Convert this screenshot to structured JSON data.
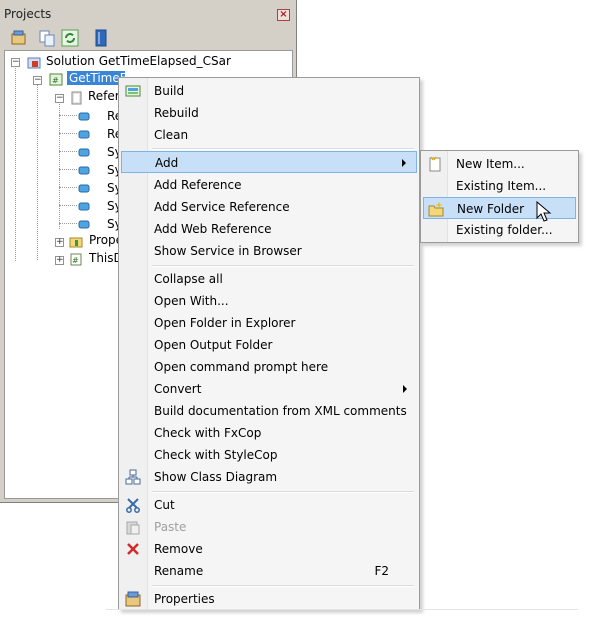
{
  "pad": {
    "title": "Projects",
    "close_glyph": "×",
    "toolbar": [
      {
        "icon": "properties-icon"
      },
      {
        "icon": "copy-icon"
      },
      {
        "icon": "refresh-icon"
      },
      {
        "icon": "collapse-icon"
      }
    ]
  },
  "tree": {
    "solution_label": "Solution GetTimeElapsed_CSar",
    "project_label": "GetTimeElapsed_CS",
    "references_label": "References",
    "reference_items": [
      "Re",
      "Re",
      "Sy",
      "Sy",
      "Sy",
      "Sy",
      "Sy"
    ],
    "properties_label": "Prope",
    "thisdoc_label": "ThisD"
  },
  "menu": {
    "items": [
      {
        "label": "Build",
        "icon": "build-icon"
      },
      {
        "label": "Rebuild"
      },
      {
        "label": "Clean"
      },
      {
        "label": "Add",
        "submenu": true,
        "highlighted": true
      },
      {
        "label": "Add Reference"
      },
      {
        "label": "Add Service Reference"
      },
      {
        "label": "Add Web Reference"
      },
      {
        "label": "Show Service in Browser"
      },
      {
        "label": "Collapse all"
      },
      {
        "label": "Open With..."
      },
      {
        "label": "Open Folder in Explorer"
      },
      {
        "label": "Open Output Folder"
      },
      {
        "label": "Open command prompt here"
      },
      {
        "label": "Convert",
        "submenu": true
      },
      {
        "label": "Build documentation from XML comments"
      },
      {
        "label": "Check with FxCop"
      },
      {
        "label": "Check with StyleCop"
      },
      {
        "label": "Show Class Diagram",
        "icon": "class-diagram-icon"
      },
      {
        "label": "Cut",
        "icon": "cut-icon"
      },
      {
        "label": "Paste",
        "icon": "paste-icon",
        "disabled": true
      },
      {
        "label": "Remove",
        "icon": "remove-icon"
      },
      {
        "label": "Rename",
        "shortcut": "F2"
      },
      {
        "label": "Properties",
        "icon": "properties-icon"
      }
    ]
  },
  "submenu": {
    "items": [
      {
        "label": "New Item...",
        "icon": "new-item-icon"
      },
      {
        "label": "Existing Item..."
      },
      {
        "label": "New Folder",
        "icon": "new-folder-icon",
        "highlighted": true
      },
      {
        "label": "Existing folder..."
      }
    ]
  },
  "colors": {
    "highlight_bg": "#c8dff8",
    "highlight_border": "#7fb2e6",
    "selection_bg": "#3a86d6"
  }
}
